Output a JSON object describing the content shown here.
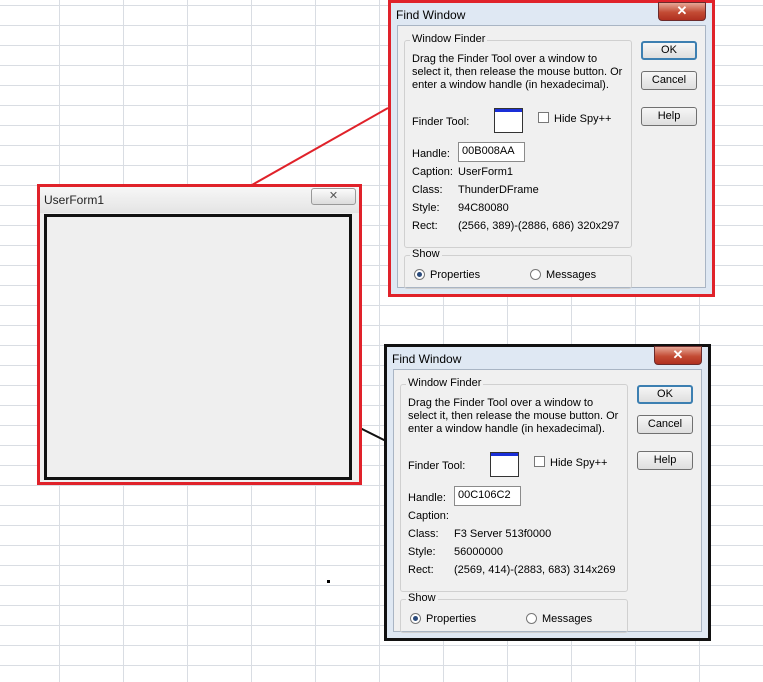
{
  "userform": {
    "title": "UserForm1",
    "close_glyph": "✕"
  },
  "dialog_top": {
    "title": "Find Window",
    "close_glyph": "✕",
    "group_finder_label": "Window Finder",
    "description": "Drag the Finder Tool over a window to select it, then release the mouse button.  Or enter a window handle (in hexadecimal).",
    "finder_tool_label": "Finder Tool:",
    "hide_spy_label": "Hide Spy++",
    "handle_label": "Handle:",
    "handle_value": "00B008AA",
    "caption_label": "Caption:",
    "caption_value": "UserForm1",
    "class_label": "Class:",
    "class_value": "ThunderDFrame",
    "style_label": "Style:",
    "style_value": "94C80080",
    "rect_label": "Rect:",
    "rect_value": "(2566, 389)-(2886, 686) 320x297",
    "show_label": "Show",
    "properties_label": "Properties",
    "messages_label": "Messages",
    "ok_label": "OK",
    "cancel_label": "Cancel",
    "help_label": "Help"
  },
  "dialog_bottom": {
    "title": "Find Window",
    "close_glyph": "✕",
    "group_finder_label": "Window Finder",
    "description": "Drag the Finder Tool over a window to select it, then release the mouse button.  Or enter a window handle (in hexadecimal).",
    "finder_tool_label": "Finder Tool:",
    "hide_spy_label": "Hide Spy++",
    "handle_label": "Handle:",
    "handle_value": "00C106C2",
    "caption_label": "Caption:",
    "caption_value": "",
    "class_label": "Class:",
    "class_value": "F3 Server 513f0000",
    "style_label": "Style:",
    "style_value": "56000000",
    "rect_label": "Rect:",
    "rect_value": "(2569, 414)-(2883, 683) 314x269",
    "show_label": "Show",
    "properties_label": "Properties",
    "messages_label": "Messages",
    "ok_label": "OK",
    "cancel_label": "Cancel",
    "help_label": "Help"
  }
}
